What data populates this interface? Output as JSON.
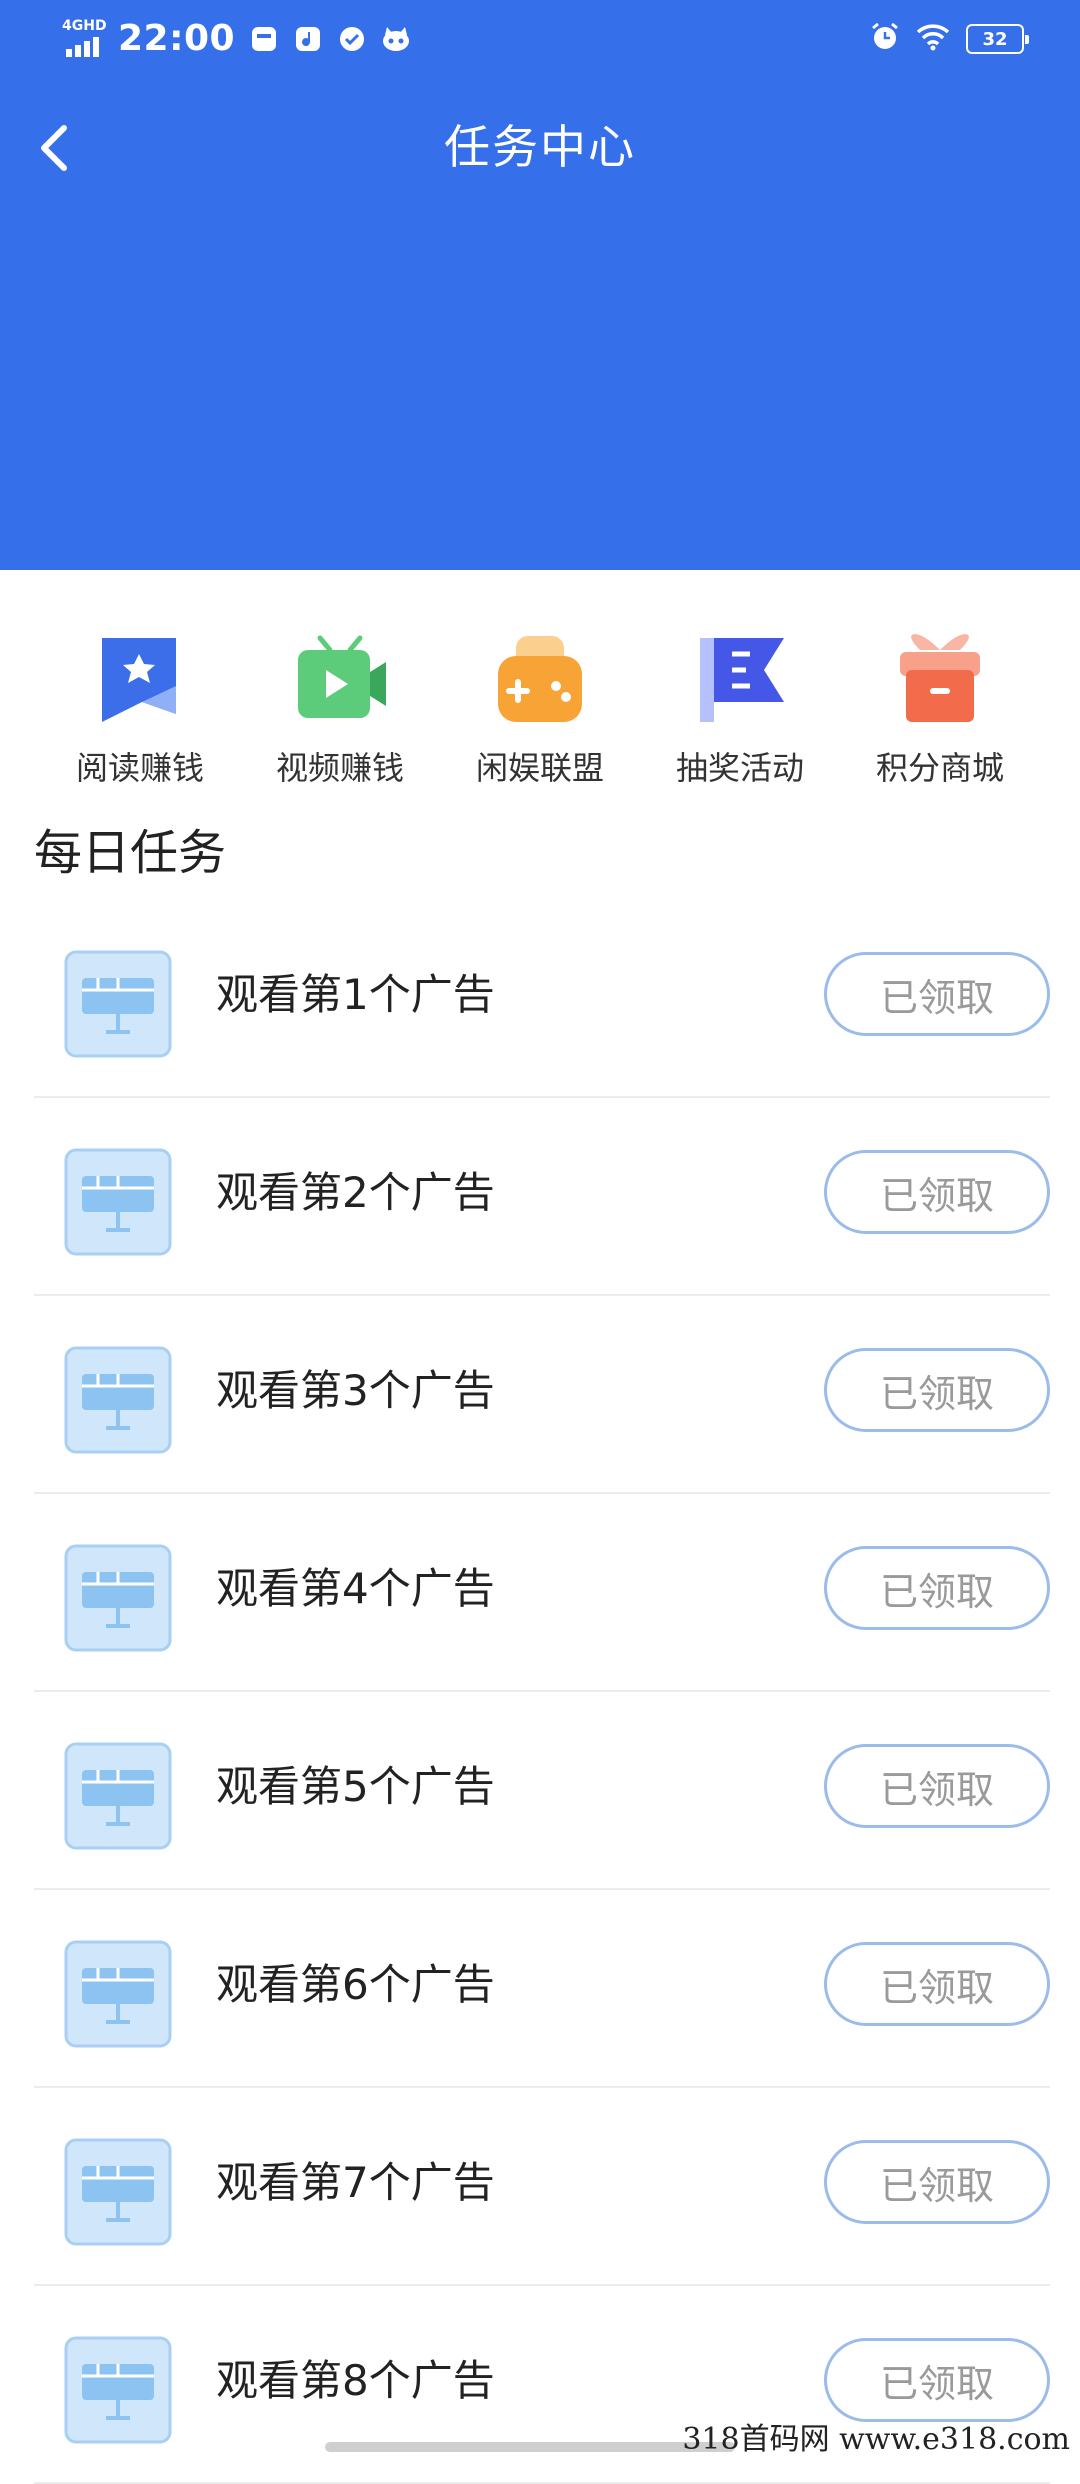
{
  "status_bar": {
    "network": "4GHD",
    "time": "22:00",
    "battery": "32"
  },
  "header": {
    "title": "任务中心"
  },
  "quick_entries": [
    {
      "label": "阅读赚钱",
      "icon": "book-star-icon",
      "color": "#3b6ee8"
    },
    {
      "label": "视频赚钱",
      "icon": "tv-play-icon",
      "color": "#5ccb7a"
    },
    {
      "label": "闲娱联盟",
      "icon": "gamepad-icon",
      "color": "#f7a335"
    },
    {
      "label": "抽奖活动",
      "icon": "flag-icon",
      "color": "#4557e6"
    },
    {
      "label": "积分商城",
      "icon": "gift-box-icon",
      "color": "#f26b4b"
    }
  ],
  "daily_tasks": {
    "title": "每日任务",
    "items": [
      {
        "label": "观看第1个广告",
        "button": "已领取"
      },
      {
        "label": "观看第2个广告",
        "button": "已领取"
      },
      {
        "label": "观看第3个广告",
        "button": "已领取"
      },
      {
        "label": "观看第4个广告",
        "button": "已领取"
      },
      {
        "label": "观看第5个广告",
        "button": "已领取"
      },
      {
        "label": "观看第6个广告",
        "button": "已领取"
      },
      {
        "label": "观看第7个广告",
        "button": "已领取"
      },
      {
        "label": "观看第8个广告",
        "button": "已领取"
      }
    ]
  },
  "watermark": "318首码网  www.e318.com",
  "colors": {
    "header_bg": "#3570ea",
    "button_border": "#9bbcea",
    "button_text": "#9a9a9a"
  }
}
